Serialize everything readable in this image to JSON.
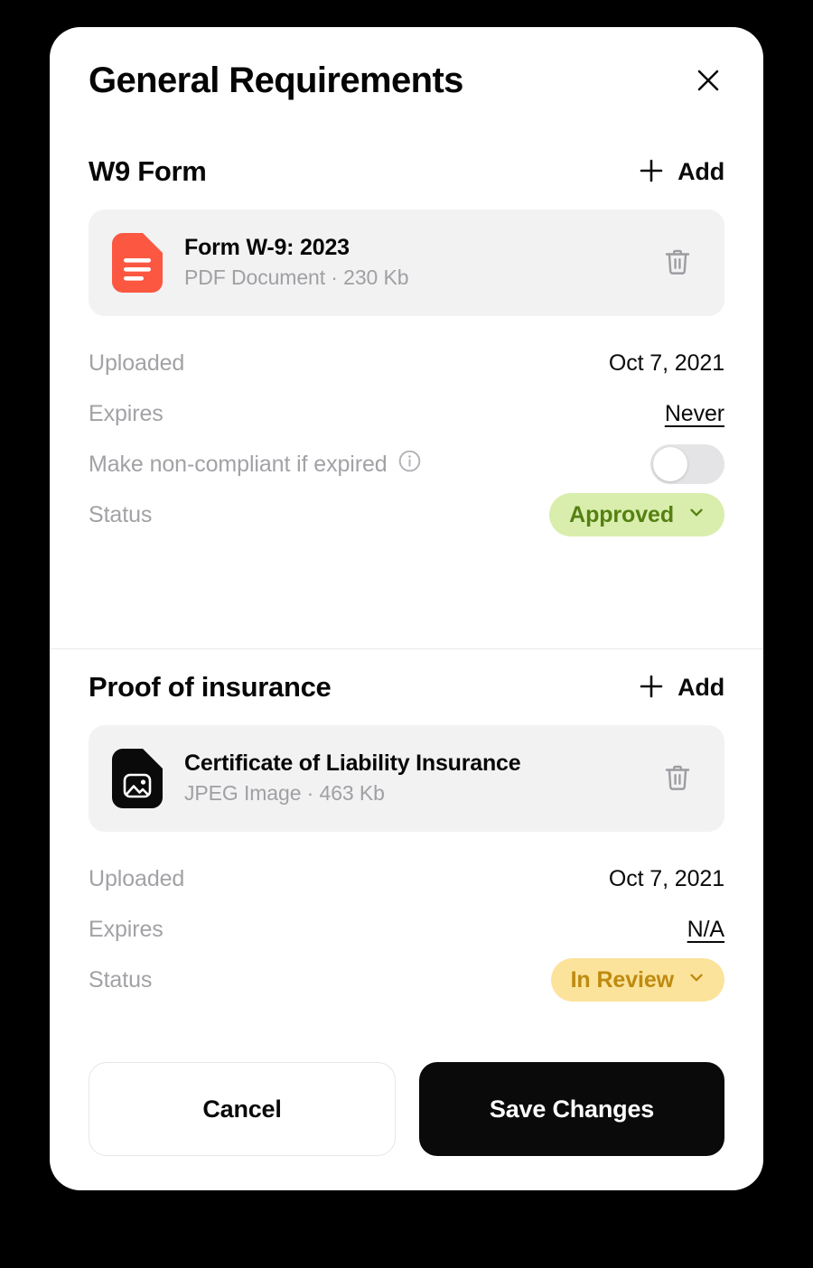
{
  "modal": {
    "title": "General Requirements",
    "close_icon": "close-icon"
  },
  "sections": [
    {
      "title": "W9 Form",
      "add_label": "Add",
      "file": {
        "name": "Form W-9: 2023",
        "meta": "PDF Document · 230 Kb",
        "icon": "pdf-document-icon",
        "icon_color": "#fb5741",
        "delete_icon": "trash-icon"
      },
      "uploaded_label": "Uploaded",
      "uploaded_value": "Oct 7, 2021",
      "expires_label": "Expires",
      "expires_value": "Never",
      "noncompliant_label": "Make non-compliant if expired",
      "noncompliant_info_icon": "info-icon",
      "noncompliant_toggle_on": false,
      "status_label": "Status",
      "status_value": "Approved",
      "status_bg": "#d9eeac",
      "status_color": "#558013"
    },
    {
      "title": "Proof of insurance",
      "add_label": "Add",
      "file": {
        "name": "Certificate of Liability Insurance",
        "meta": "JPEG Image · 463 Kb",
        "icon": "image-document-icon",
        "icon_color": "#0a0a0a",
        "delete_icon": "trash-icon"
      },
      "uploaded_label": "Uploaded",
      "uploaded_value": "Oct 7, 2021",
      "expires_label": "Expires",
      "expires_value": "N/A",
      "status_label": "Status",
      "status_value": "In Review",
      "status_bg": "#fbe39b",
      "status_color": "#bf8a10"
    }
  ],
  "footer": {
    "cancel_label": "Cancel",
    "save_label": "Save Changes"
  }
}
